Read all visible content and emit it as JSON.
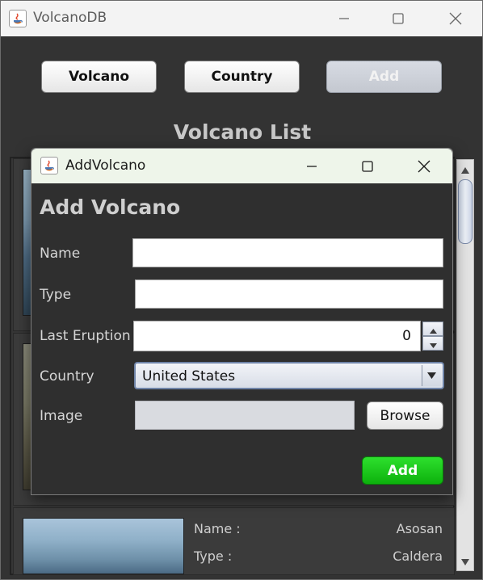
{
  "main_window": {
    "title": "VolcanoDB",
    "icon": "java-app-icon",
    "controls": [
      "minimize-icon",
      "maximize-icon",
      "close-icon"
    ]
  },
  "nav": {
    "volcano_label": "Volcano",
    "country_label": "Country",
    "add_label": "Add"
  },
  "list": {
    "title": "Volcano List",
    "visible_card": {
      "name_label": "Name :",
      "name_value": "Asosan",
      "type_label": "Type :",
      "type_value": "Caldera"
    }
  },
  "dialog": {
    "title": "AddVolcano",
    "icon": "java-app-icon",
    "heading": "Add Volcano",
    "fields": {
      "name_label": "Name",
      "name_value": "",
      "type_label": "Type",
      "type_value": "",
      "eruption_label": "Last Eruption",
      "eruption_value": "0",
      "country_label": "Country",
      "country_value": "United States",
      "image_label": "Image",
      "image_value": ""
    },
    "browse_label": "Browse",
    "add_label": "Add"
  },
  "colors": {
    "window_bg": "#333333",
    "add_button": "#16c416",
    "dialog_titlebar": "#eef5ea"
  }
}
